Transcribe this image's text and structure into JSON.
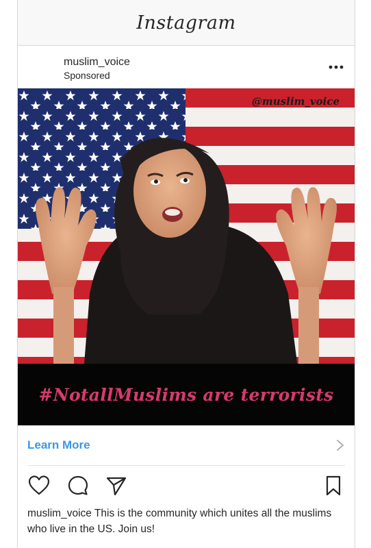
{
  "app": {
    "title": "Instagram"
  },
  "post": {
    "username": "muslim_voice",
    "sponsored_label": "Sponsored",
    "more_icon": "more-horizontal-icon",
    "image": {
      "watermark": "@muslim_voice",
      "banner_text": "#NotallMuslims are terrorists",
      "banner_text_color": "#d83a6d",
      "banner_background": "#050505"
    },
    "cta": {
      "label": "Learn More",
      "color": "#3b97e3",
      "icon": "chevron-right-icon"
    },
    "actions": [
      "heart-icon",
      "comment-icon",
      "share-icon",
      "bookmark-icon"
    ],
    "caption": {
      "username": "muslim_voice",
      "text": "This is the community which unites all the muslims who live in the US. Join us!"
    }
  }
}
